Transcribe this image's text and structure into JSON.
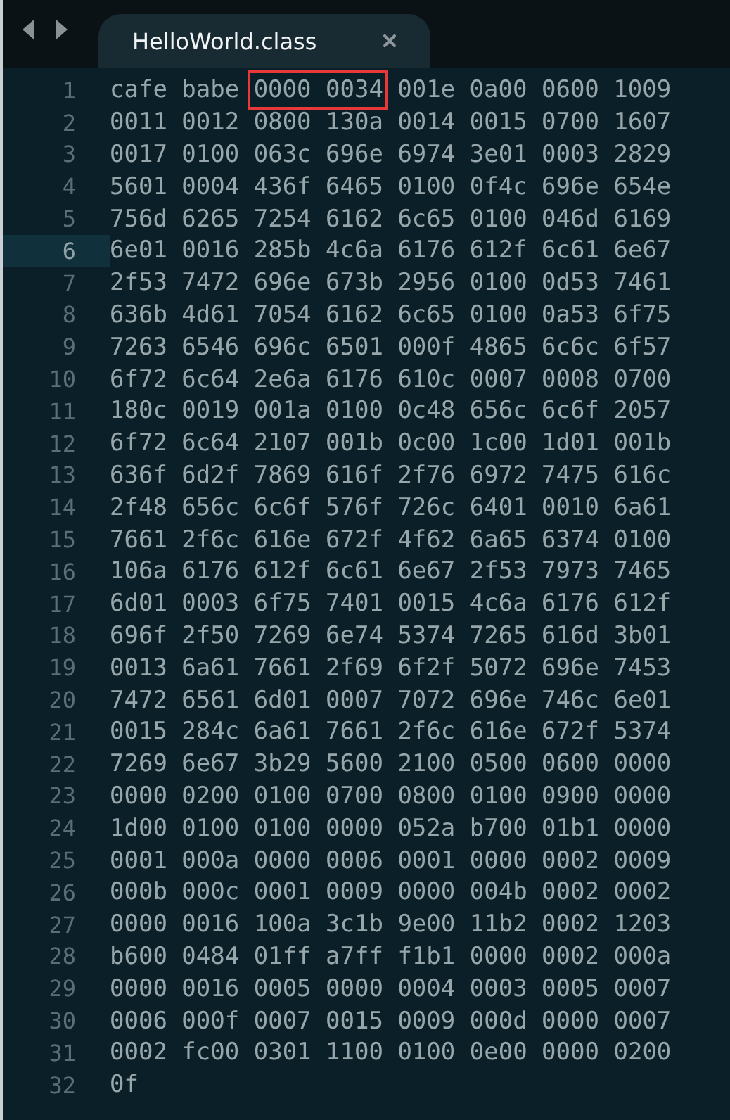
{
  "tabs": [
    {
      "title": "HelloWorld.class",
      "selected": true
    }
  ],
  "lines": [
    {
      "number": "1",
      "current": false,
      "parts": [
        {
          "text": "cafe babe",
          "boxed": false
        },
        {
          "text": "0000 0034",
          "boxed": true
        },
        {
          "text": "001e 0a00 0600 1009",
          "boxed": false
        }
      ]
    },
    {
      "number": "2",
      "current": false,
      "parts": [
        {
          "text": "0011 0012 0800 130a 0014 0015 0700 1607",
          "boxed": false
        }
      ]
    },
    {
      "number": "3",
      "current": false,
      "parts": [
        {
          "text": "0017 0100 063c 696e 6974 3e01 0003 2829",
          "boxed": false
        }
      ]
    },
    {
      "number": "4",
      "current": false,
      "parts": [
        {
          "text": "5601 0004 436f 6465 0100 0f4c 696e 654e",
          "boxed": false
        }
      ]
    },
    {
      "number": "5",
      "current": false,
      "parts": [
        {
          "text": "756d 6265 7254 6162 6c65 0100 046d 6169",
          "boxed": false
        }
      ]
    },
    {
      "number": "6",
      "current": true,
      "parts": [
        {
          "text": "6e01 0016 285b 4c6a 6176 612f 6c61 6e67",
          "boxed": false
        }
      ]
    },
    {
      "number": "7",
      "current": false,
      "parts": [
        {
          "text": "2f53 7472 696e 673b 2956 0100 0d53 7461",
          "boxed": false
        }
      ]
    },
    {
      "number": "8",
      "current": false,
      "parts": [
        {
          "text": "636b 4d61 7054 6162 6c65 0100 0a53 6f75",
          "boxed": false
        }
      ]
    },
    {
      "number": "9",
      "current": false,
      "parts": [
        {
          "text": "7263 6546 696c 6501 000f 4865 6c6c 6f57",
          "boxed": false
        }
      ]
    },
    {
      "number": "10",
      "current": false,
      "parts": [
        {
          "text": "6f72 6c64 2e6a 6176 610c 0007 0008 0700",
          "boxed": false
        }
      ]
    },
    {
      "number": "11",
      "current": false,
      "parts": [
        {
          "text": "180c 0019 001a 0100 0c48 656c 6c6f 2057",
          "boxed": false
        }
      ]
    },
    {
      "number": "12",
      "current": false,
      "parts": [
        {
          "text": "6f72 6c64 2107 001b 0c00 1c00 1d01 001b",
          "boxed": false
        }
      ]
    },
    {
      "number": "13",
      "current": false,
      "parts": [
        {
          "text": "636f 6d2f 7869 616f 2f76 6972 7475 616c",
          "boxed": false
        }
      ]
    },
    {
      "number": "14",
      "current": false,
      "parts": [
        {
          "text": "2f48 656c 6c6f 576f 726c 6401 0010 6a61",
          "boxed": false
        }
      ]
    },
    {
      "number": "15",
      "current": false,
      "parts": [
        {
          "text": "7661 2f6c 616e 672f 4f62 6a65 6374 0100",
          "boxed": false
        }
      ]
    },
    {
      "number": "16",
      "current": false,
      "parts": [
        {
          "text": "106a 6176 612f 6c61 6e67 2f53 7973 7465",
          "boxed": false
        }
      ]
    },
    {
      "number": "17",
      "current": false,
      "parts": [
        {
          "text": "6d01 0003 6f75 7401 0015 4c6a 6176 612f",
          "boxed": false
        }
      ]
    },
    {
      "number": "18",
      "current": false,
      "parts": [
        {
          "text": "696f 2f50 7269 6e74 5374 7265 616d 3b01",
          "boxed": false
        }
      ]
    },
    {
      "number": "19",
      "current": false,
      "parts": [
        {
          "text": "0013 6a61 7661 2f69 6f2f 5072 696e 7453",
          "boxed": false
        }
      ]
    },
    {
      "number": "20",
      "current": false,
      "parts": [
        {
          "text": "7472 6561 6d01 0007 7072 696e 746c 6e01",
          "boxed": false
        }
      ]
    },
    {
      "number": "21",
      "current": false,
      "parts": [
        {
          "text": "0015 284c 6a61 7661 2f6c 616e 672f 5374",
          "boxed": false
        }
      ]
    },
    {
      "number": "22",
      "current": false,
      "parts": [
        {
          "text": "7269 6e67 3b29 5600 2100 0500 0600 0000",
          "boxed": false
        }
      ]
    },
    {
      "number": "23",
      "current": false,
      "parts": [
        {
          "text": "0000 0200 0100 0700 0800 0100 0900 0000",
          "boxed": false
        }
      ]
    },
    {
      "number": "24",
      "current": false,
      "parts": [
        {
          "text": "1d00 0100 0100 0000 052a b700 01b1 0000",
          "boxed": false
        }
      ]
    },
    {
      "number": "25",
      "current": false,
      "parts": [
        {
          "text": "0001 000a 0000 0006 0001 0000 0002 0009",
          "boxed": false
        }
      ]
    },
    {
      "number": "26",
      "current": false,
      "parts": [
        {
          "text": "000b 000c 0001 0009 0000 004b 0002 0002",
          "boxed": false
        }
      ]
    },
    {
      "number": "27",
      "current": false,
      "parts": [
        {
          "text": "0000 0016 100a 3c1b 9e00 11b2 0002 1203",
          "boxed": false
        }
      ]
    },
    {
      "number": "28",
      "current": false,
      "parts": [
        {
          "text": "b600 0484 01ff a7ff f1b1 0000 0002 000a",
          "boxed": false
        }
      ]
    },
    {
      "number": "29",
      "current": false,
      "parts": [
        {
          "text": "0000 0016 0005 0000 0004 0003 0005 0007",
          "boxed": false
        }
      ]
    },
    {
      "number": "30",
      "current": false,
      "parts": [
        {
          "text": "0006 000f 0007 0015 0009 000d 0000 0007",
          "boxed": false
        }
      ]
    },
    {
      "number": "31",
      "current": false,
      "parts": [
        {
          "text": "0002 fc00 0301 1100 0100 0e00 0000 0200",
          "boxed": false
        }
      ]
    },
    {
      "number": "32",
      "current": false,
      "parts": [
        {
          "text": "0f",
          "boxed": false
        }
      ]
    }
  ]
}
